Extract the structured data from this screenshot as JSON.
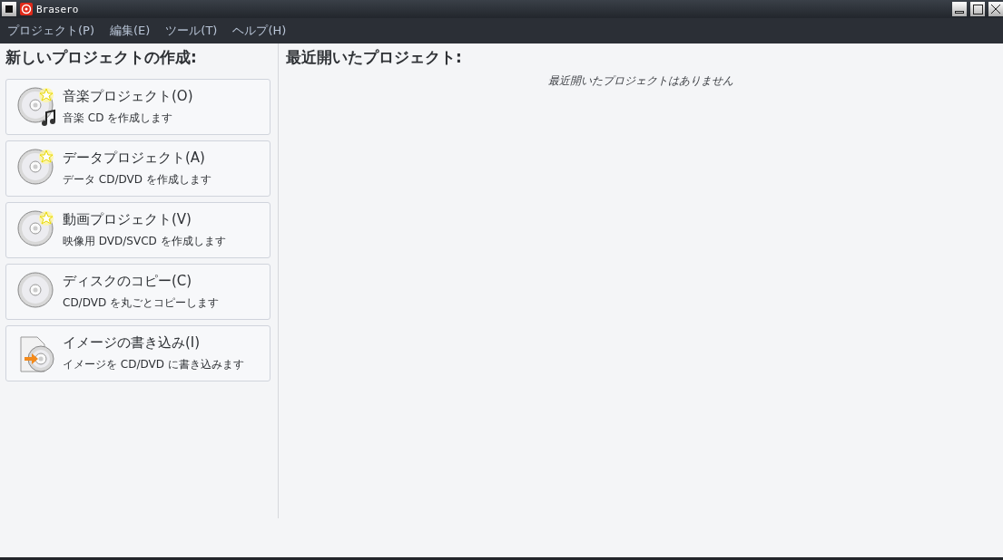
{
  "window": {
    "title": "Brasero"
  },
  "menu": [
    "プロジェクト(P)",
    "編集(E)",
    "ツール(T)",
    "ヘルプ(H)"
  ],
  "new_project": {
    "heading": "新しいプロジェクトの作成:",
    "items": [
      {
        "kind": "music",
        "title": "音楽プロジェクト(O)",
        "subtitle": "音楽 CD を作成します"
      },
      {
        "kind": "data",
        "title": "データプロジェクト(A)",
        "subtitle": "データ CD/DVD を作成します"
      },
      {
        "kind": "video",
        "title": "動画プロジェクト(V)",
        "subtitle": "映像用 DVD/SVCD を作成します"
      },
      {
        "kind": "copy",
        "title": "ディスクのコピー(C)",
        "subtitle": "CD/DVD を丸ごとコピーします"
      },
      {
        "kind": "image",
        "title": "イメージの書き込み(I)",
        "subtitle": "イメージを CD/DVD に書き込みます"
      }
    ]
  },
  "recent": {
    "heading": "最近開いたプロジェクト:",
    "empty_message": "最近開いたプロジェクトはありません"
  }
}
